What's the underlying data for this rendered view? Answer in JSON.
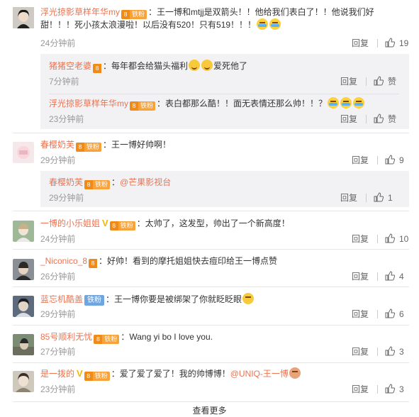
{
  "reply_label": "回复",
  "like_label": "赞",
  "tie_label": "铁粉",
  "level_label": "8",
  "load_more": "查看更多",
  "comments": [
    {
      "name": "浮光掠影草样年华my",
      "text": "：王一博和mtjj是双箭头！！他给我们表白了！！他说我们好甜！！！死小孩太浪漫啦！以后没有520！只有519！！！",
      "time": "24分钟前",
      "likes": "19",
      "replies": [
        {
          "name": "猪猪空老婆",
          "text": "：每年都会给猫头福利",
          "text2": "爱死他了",
          "time": "7分钟前",
          "likes": "赞"
        },
        {
          "name": "浮光掠影草样年华my",
          "text": "：表白都那么酷！！面无表情还那么帅！！？",
          "time": "23分钟前",
          "likes": "赞"
        }
      ]
    },
    {
      "name": "春樱奶芙",
      "text": "：王一博好帅啊！",
      "time": "29分钟前",
      "likes": "9",
      "replies": [
        {
          "name": "春樱奶芙",
          "text": "：",
          "mention": "@芒果影视台",
          "time": "29分钟前",
          "likes": "1"
        }
      ]
    },
    {
      "name": "一博的小乐姐姐",
      "text": "：太帅了，这发型，帅出了一个新高度！",
      "time": "24分钟前",
      "likes": "10"
    },
    {
      "name": "_Niconico_8",
      "text": "：好帅！看到的摩托姐姐快去痘印给王一博点赞",
      "time": "26分钟前",
      "likes": "4"
    },
    {
      "name": "蓝忘机酷盖",
      "text": "：王一博你要是被绑架了你就眨眨眼",
      "time": "29分钟前",
      "likes": "6"
    },
    {
      "name": "85号顺利无忧",
      "text": "：Wang yi bo I love you.",
      "time": "27分钟前",
      "likes": "3"
    },
    {
      "name": "是一拨的",
      "text": "：爱了爱了爱了！我的帅博博！",
      "mention": "@UNIQ-王一博",
      "time": "23分钟前",
      "likes": "3"
    }
  ],
  "colors": {
    "name": "#eb7350",
    "muted": "#999999",
    "sub_bg": "#f2f2f5",
    "badge": "#f8a23a",
    "tie_blue": "#6fa6df"
  }
}
